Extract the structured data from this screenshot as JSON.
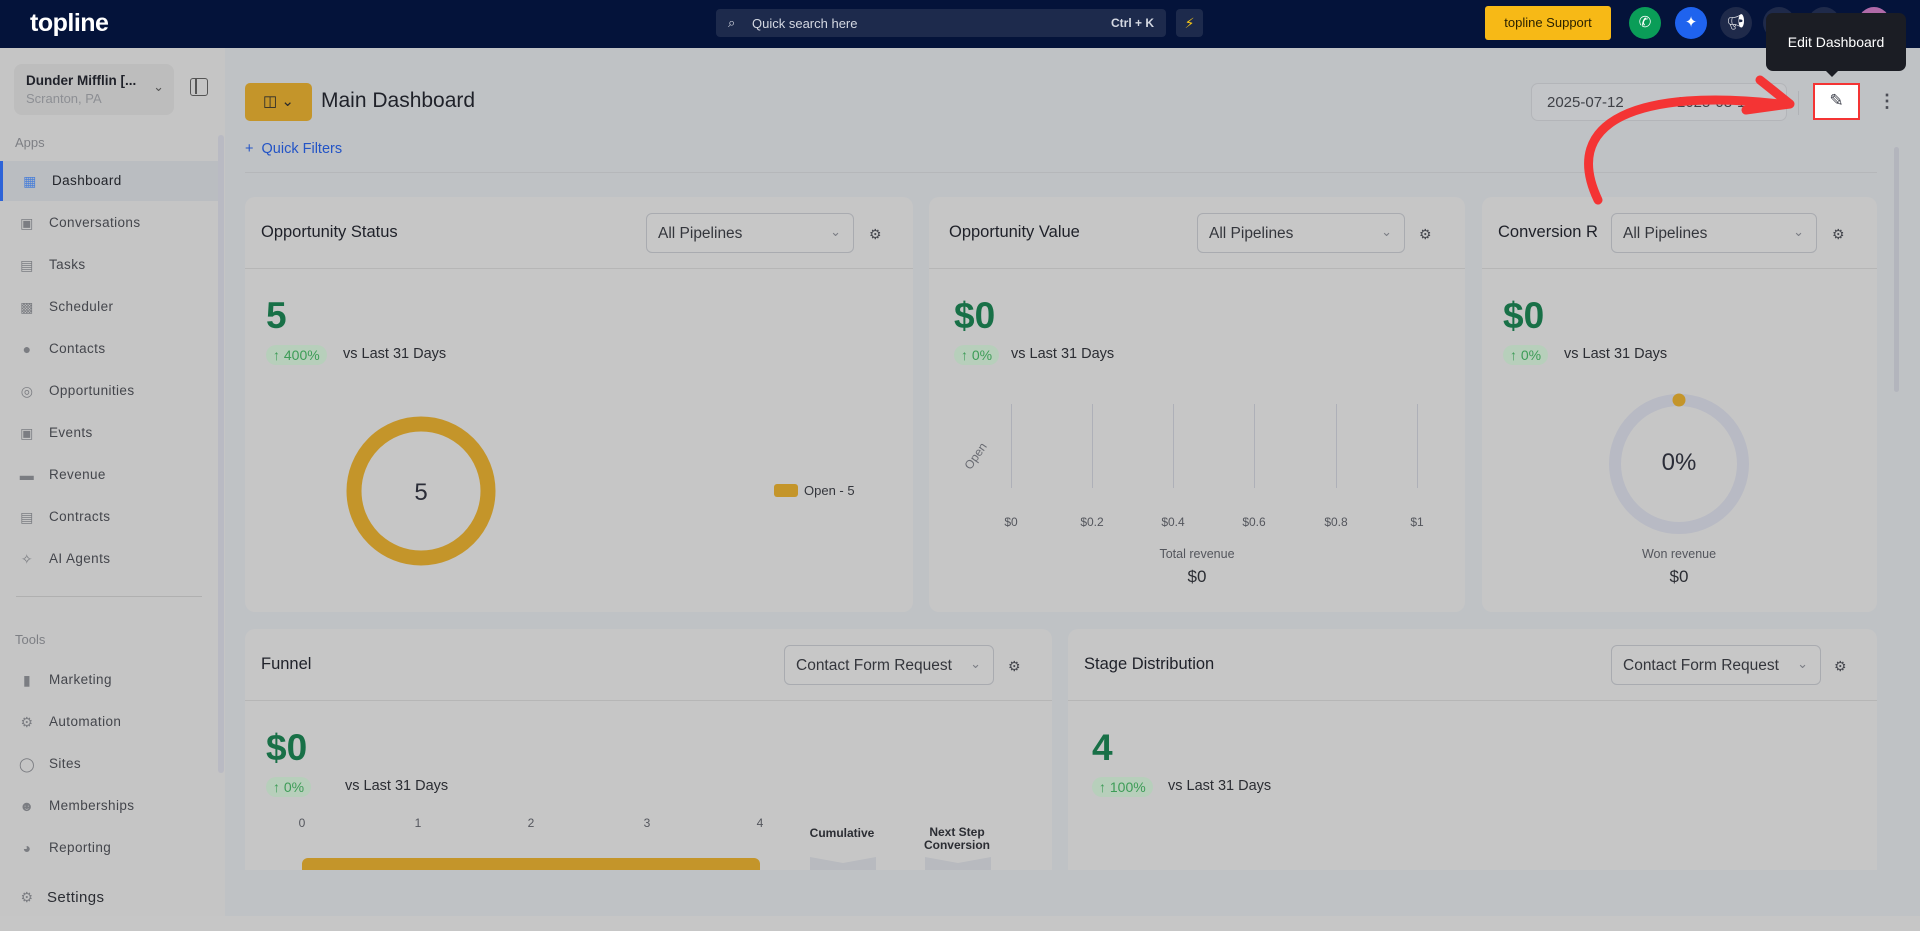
{
  "topbar": {
    "logo": "topline",
    "search_placeholder": "Quick search here",
    "search_shortcut": "Ctrl + K",
    "support_label": "topline Support",
    "tooltip": "Edit Dashboard",
    "colors": {
      "bg": "#04133a",
      "support": "#f7b916",
      "phone": "#0a9d58",
      "ai": "#1f63ee"
    }
  },
  "sidebar": {
    "account_name": "Dunder Mifflin [...",
    "account_location": "Scranton, PA",
    "apps_label": "Apps",
    "apps": [
      {
        "label": "Dashboard",
        "icon": "dashboard-icon"
      },
      {
        "label": "Conversations",
        "icon": "chat-icon"
      },
      {
        "label": "Tasks",
        "icon": "task-icon"
      },
      {
        "label": "Scheduler",
        "icon": "calendar-icon"
      },
      {
        "label": "Contacts",
        "icon": "person-icon"
      },
      {
        "label": "Opportunities",
        "icon": "target-icon"
      },
      {
        "label": "Events",
        "icon": "events-icon"
      },
      {
        "label": "Revenue",
        "icon": "card-icon"
      },
      {
        "label": "Contracts",
        "icon": "document-icon"
      },
      {
        "label": "AI Agents",
        "icon": "sparkle-icon"
      }
    ],
    "tools_label": "Tools",
    "tools": [
      {
        "label": "Marketing",
        "icon": "megaphone-icon"
      },
      {
        "label": "Automation",
        "icon": "gears-icon"
      },
      {
        "label": "Sites",
        "icon": "globe-icon"
      },
      {
        "label": "Memberships",
        "icon": "users-icon"
      },
      {
        "label": "Reporting",
        "icon": "pie-icon"
      }
    ],
    "settings_label": "Settings"
  },
  "header": {
    "title": "Main Dashboard",
    "date_start": "2025-07-12",
    "date_end": "2025-08-11",
    "quick_filters": "Quick Filters"
  },
  "widgets": {
    "opportunity_status": {
      "title": "Opportunity Status",
      "filter": "All Pipelines",
      "value": "5",
      "change": "400%",
      "compare": "vs Last 31 Days",
      "donut_center": "5",
      "legend": "Open - 5"
    },
    "opportunity_value": {
      "title": "Opportunity Value",
      "filter": "All Pipelines",
      "value": "$0",
      "change": "0%",
      "compare": "vs Last 31 Days",
      "category": "Open",
      "ticks": [
        "$0",
        "$0.2",
        "$0.4",
        "$0.6",
        "$0.8",
        "$1"
      ],
      "total_label": "Total revenue",
      "total_value": "$0"
    },
    "conversion_rate": {
      "title": "Conversion R",
      "filter": "All Pipelines",
      "value": "$0",
      "change": "0%",
      "compare": "vs Last 31 Days",
      "donut_center": "0%",
      "won_label": "Won revenue",
      "won_value": "$0"
    },
    "funnel": {
      "title": "Funnel",
      "filter": "Contact Form Request",
      "value": "$0",
      "change": "0%",
      "compare": "vs Last 31 Days",
      "ticks": [
        "0",
        "1",
        "2",
        "3",
        "4"
      ],
      "col_cumulative": "Cumulative",
      "col_next": "Next Step Conversion"
    },
    "stage_distribution": {
      "title": "Stage Distribution",
      "filter": "Contact Form Request",
      "value": "4",
      "change": "100%",
      "compare": "vs Last 31 Days"
    }
  }
}
